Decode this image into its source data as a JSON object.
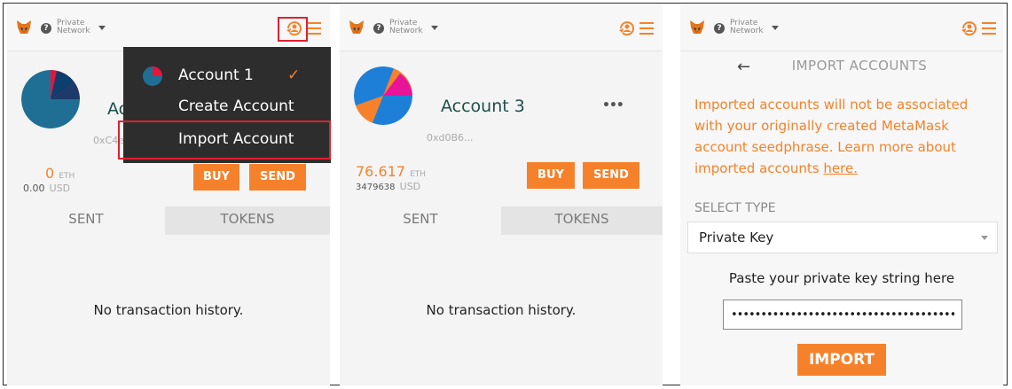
{
  "network": {
    "label_line1": "Private",
    "label_line2": "Network"
  },
  "colors": {
    "accent": "#f5822b",
    "dropdown_bg": "#2d2d2d",
    "highlight": "#e02030"
  },
  "icons": {
    "fox": "metamask-fox-icon",
    "help": "help-icon",
    "account_switch": "account-switch-icon",
    "menu": "hamburger-menu-icon",
    "check": "checkmark-icon",
    "back": "back-arrow-icon"
  },
  "panel1": {
    "account_name": "Account 1",
    "address": "0xC4e5...",
    "balance": {
      "eth": "0",
      "eth_unit": "ETH",
      "usd": "0.00",
      "usd_unit": "USD"
    },
    "buy": "BUY",
    "send": "SEND",
    "tabs": [
      "SENT",
      "TOKENS"
    ],
    "empty": "No transaction history.",
    "dropdown": {
      "items": [
        {
          "label": "Account 1",
          "check": "✓"
        },
        {
          "label": "Create Account"
        },
        {
          "label": "Import Account"
        }
      ]
    }
  },
  "panel2": {
    "account_name": "Account 3",
    "address": "0xd0B6...",
    "balance": {
      "eth": "76.617",
      "eth_unit": "ETH",
      "usd": "3479638",
      "usd_unit": "USD"
    },
    "buy": "BUY",
    "send": "SEND",
    "tabs": [
      "SENT",
      "TOKENS"
    ],
    "empty": "No transaction history."
  },
  "panel3": {
    "title": "IMPORT ACCOUNTS",
    "notice": "Imported accounts will not be associated with your originally created MetaMask account seedphrase. Learn more about imported accounts ",
    "notice_link": "here.",
    "select_label": "SELECT TYPE",
    "select_value": "Private Key",
    "paste_label": "Paste your private key string here",
    "input_value": "••••••••••••••••••••••••••••••••••••••",
    "import_button": "IMPORT"
  }
}
